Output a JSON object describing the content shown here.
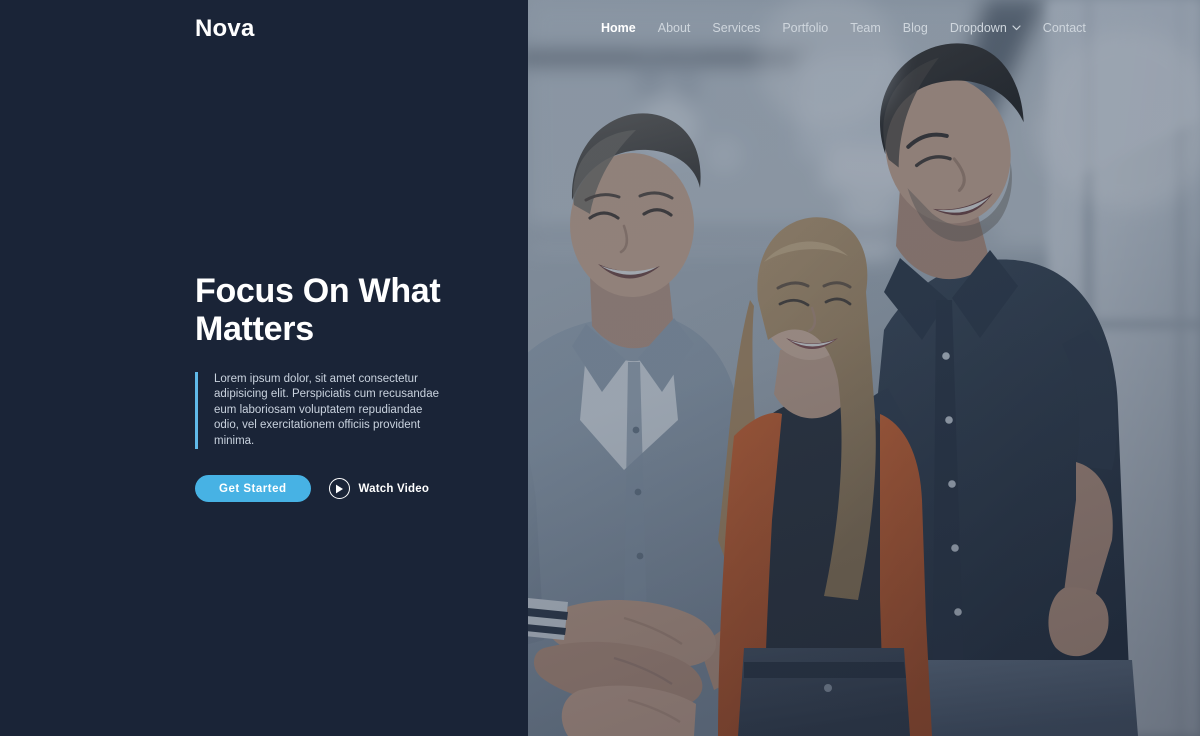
{
  "brand": {
    "name": "Nova"
  },
  "nav": {
    "items": [
      {
        "label": "Home",
        "active": true,
        "has_dropdown": false
      },
      {
        "label": "About",
        "active": false,
        "has_dropdown": false
      },
      {
        "label": "Services",
        "active": false,
        "has_dropdown": false
      },
      {
        "label": "Portfolio",
        "active": false,
        "has_dropdown": false
      },
      {
        "label": "Team",
        "active": false,
        "has_dropdown": false
      },
      {
        "label": "Blog",
        "active": false,
        "has_dropdown": false
      },
      {
        "label": "Dropdown",
        "active": false,
        "has_dropdown": true
      },
      {
        "label": "Contact",
        "active": false,
        "has_dropdown": false
      }
    ]
  },
  "hero": {
    "title": "Focus On What Matters",
    "paragraph": "Lorem ipsum dolor, sit amet consectetur adipisicing elit. Perspiciatis cum recusandae eum laboriosam voluptatem repudiandae odio, vel exercitationem officiis provident minima.",
    "primary_button": "Get Started",
    "video_button": "Watch Video",
    "video_icon": "play-icon"
  },
  "photo": {
    "alt": "Three colleagues in a bright office joining hands in a team gesture",
    "overlay": "blue-gray tint"
  },
  "colors": {
    "panel_background": "#1a2437",
    "accent": "#47b2e4",
    "accent_bar": "#60b9e8",
    "heading": "#ffffff",
    "paragraph": "#c9d2de",
    "nav_link": "#cfd6dd",
    "nav_link_active": "#ffffff"
  }
}
